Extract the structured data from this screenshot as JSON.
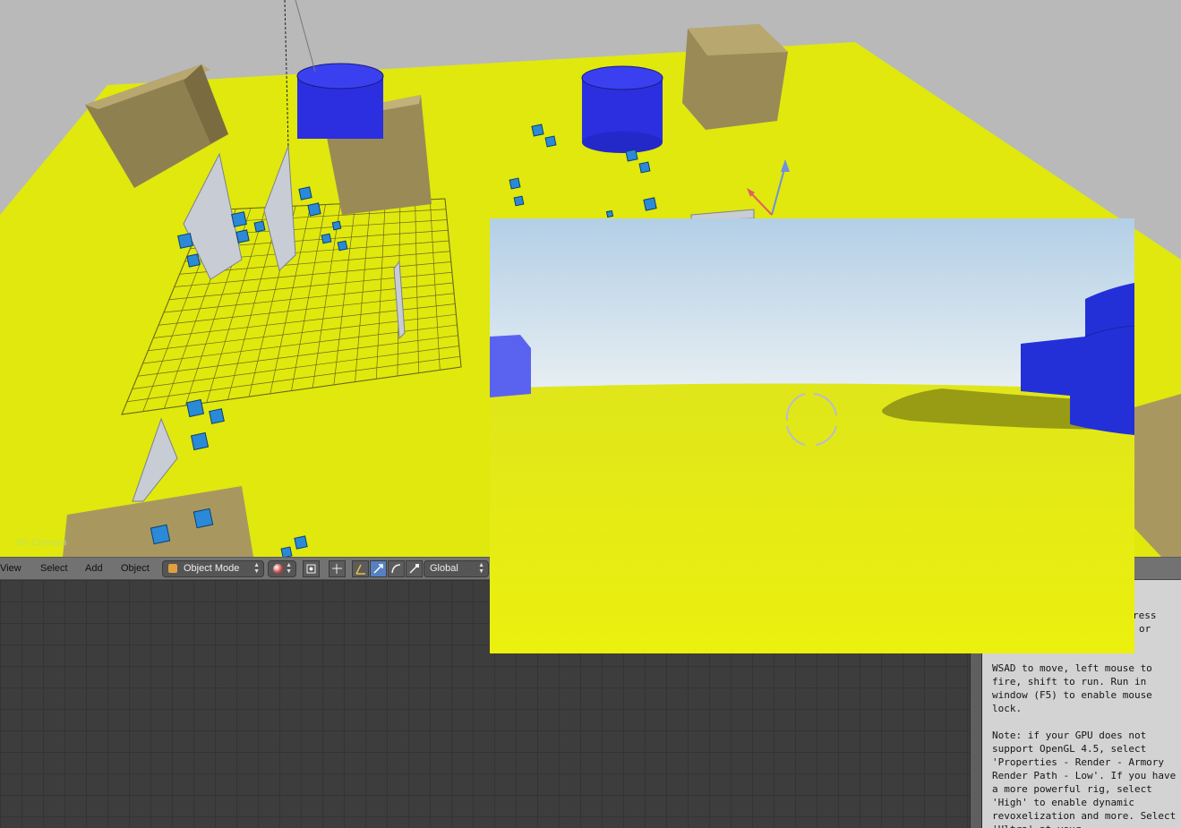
{
  "viewport": {
    "camera_label": "(0) Camera",
    "ground_color": "#e0e80e",
    "crate_color": "#a89860",
    "cylinder_color": "#2b2fe0",
    "small_cube_color": "#2a8ad8"
  },
  "header": {
    "menus": [
      "View",
      "Select",
      "Add",
      "Object"
    ],
    "mode_label": "Object Mode",
    "orientation_label": "Global"
  },
  "text_panel": {
    "partial_top_1": "ress",
    "partial_top_2": "or",
    "body": "WSAD to move, left mouse to fire, shift to run. Run in window (F5) to enable mouse lock.\n\nNote: if your GPU does not support OpenGL 4.5, select 'Properties - Render - Armory Render Path - Low'. If you have a more powerful rig, select 'High' to enable dynamic revoxelization and more. Select 'Ultra' at your"
  },
  "game_window": {
    "sky_top": "#b3cfe6",
    "sky_horizon": "#e6eef2",
    "ground_color": "#e7ee14",
    "cylinder_color": "#2330d8"
  }
}
